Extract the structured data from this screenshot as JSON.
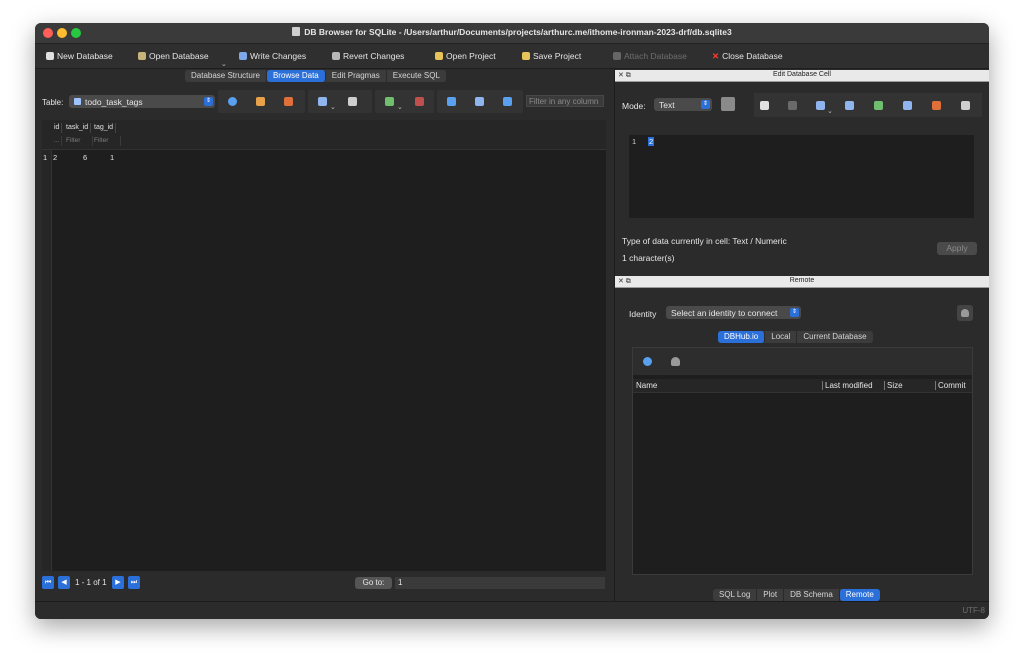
{
  "window": {
    "title": "DB Browser for SQLite - /Users/arthur/Documents/projects/arthurc.me/ithome-ironman-2023-drf/db.sqlite3"
  },
  "toolbar": {
    "new_database": "New Database",
    "open_database": "Open Database",
    "write_changes": "Write Changes",
    "revert_changes": "Revert Changes",
    "open_project": "Open Project",
    "save_project": "Save Project",
    "attach_database": "Attach Database",
    "close_database": "Close Database"
  },
  "main_tabs": [
    "Database Structure",
    "Browse Data",
    "Edit Pragmas",
    "Execute SQL"
  ],
  "browse": {
    "table_label": "Table:",
    "table_value": "todo_task_tags",
    "filter_placeholder": "Filter in any column",
    "columns": [
      "id",
      "task_id",
      "tag_id"
    ],
    "filter_label": "Filter",
    "row_index_filter": "...",
    "rows": [
      {
        "num": "1",
        "cells": [
          "2",
          "6",
          "1"
        ]
      }
    ],
    "nav_text": "1 - 1 of 1",
    "goto_label": "Go to:",
    "goto_value": "1"
  },
  "edit_cell": {
    "panel_title": "Edit Database Cell",
    "mode_label": "Mode:",
    "mode_value": "Text",
    "line_number": "1",
    "value": "2",
    "type_info": "Type of data currently in cell: Text / Numeric",
    "char_count": "1 character(s)",
    "apply_label": "Apply"
  },
  "remote": {
    "panel_title": "Remote",
    "identity_label": "Identity",
    "identity_value": "Select an identity to connect",
    "tabs": [
      "DBHub.io",
      "Local",
      "Current Database"
    ],
    "columns": [
      "Name",
      "Last modified",
      "Size",
      "Commit"
    ]
  },
  "bottom_tabs": [
    "SQL Log",
    "Plot",
    "DB Schema",
    "Remote"
  ],
  "status": {
    "encoding": "UTF-8"
  },
  "colors": {
    "accent": "#2b6fd8",
    "panel_bg": "#2b2b2b",
    "grid_bg": "#1e1e1e"
  }
}
